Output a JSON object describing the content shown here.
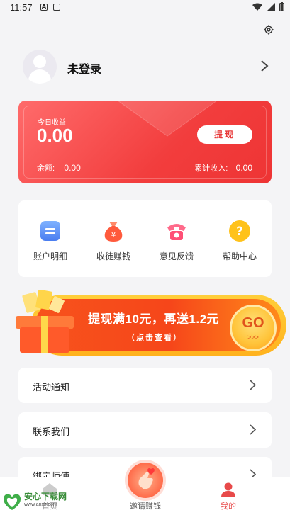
{
  "status_bar": {
    "time": "11:57",
    "icon_a": "A"
  },
  "profile": {
    "name": "未登录"
  },
  "wallet": {
    "today_label": "今日收益",
    "today_value": "0.00",
    "withdraw_label": "提现",
    "balance_label": "余额:",
    "balance_value": "0.00",
    "total_label": "累计收入:",
    "total_value": "0.00"
  },
  "menu": {
    "items": [
      {
        "label": "账户明细",
        "icon": "account-detail-icon"
      },
      {
        "label": "收徒赚钱",
        "icon": "money-bag-icon"
      },
      {
        "label": "意见反馈",
        "icon": "phone-icon"
      },
      {
        "label": "帮助中心",
        "icon": "help-icon"
      }
    ]
  },
  "banner": {
    "title": "提现满10元，再送1.2元",
    "subtitle": "（点击查看）",
    "go": "GO",
    "go_arrows": ">>>"
  },
  "list": {
    "items": [
      {
        "label": "活动通知"
      },
      {
        "label": "联系我们"
      },
      {
        "label": "绑定师傅"
      }
    ]
  },
  "bottom_nav": {
    "items": [
      {
        "label": "首页",
        "active": false
      },
      {
        "label": "邀请赚钱",
        "active": false
      },
      {
        "label": "我的",
        "active": true
      }
    ]
  },
  "watermark": {
    "name": "安心下载网",
    "url": "www.anxz.com"
  },
  "colors": {
    "accent": "#f23d3d",
    "active_nav": "#e84a4a"
  }
}
